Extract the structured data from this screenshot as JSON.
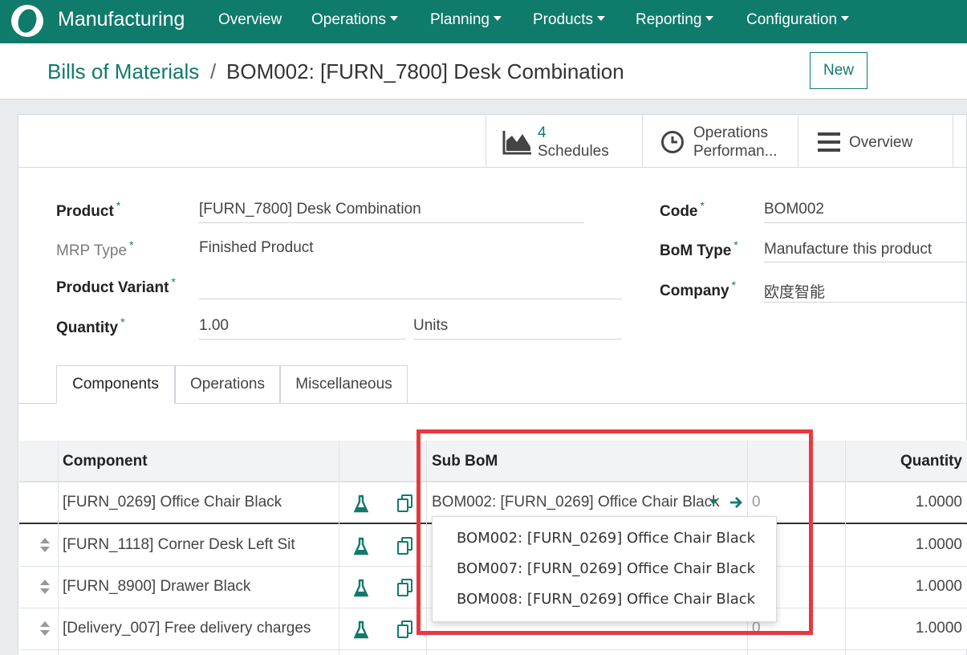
{
  "navbar": {
    "app_name": "Manufacturing",
    "menu": [
      "Overview",
      "Operations",
      "Planning",
      "Products",
      "Reporting",
      "Configuration"
    ]
  },
  "breadcrumb": {
    "parent": "Bills of Materials",
    "separator": "/",
    "current": "BOM002: [FURN_7800] Desk Combination"
  },
  "actions": {
    "new_label": "New"
  },
  "stat_buttons": {
    "schedules_count": "4",
    "schedules_label": "Schedules",
    "operations_line1": "Operations",
    "operations_line2": "Performan...",
    "overview_label": "Overview"
  },
  "form": {
    "product_label": "Product",
    "product_value": "[FURN_7800] Desk Combination",
    "mrp_type_label": "MRP Type",
    "mrp_type_value": "Finished Product",
    "variant_label": "Product Variant",
    "variant_value": "",
    "quantity_label": "Quantity",
    "quantity_value": "1.00",
    "uom_value": "Units",
    "code_label": "Code",
    "code_value": "BOM002",
    "bom_type_label": "BoM Type",
    "bom_type_value": "Manufacture this product",
    "company_label": "Company",
    "company_value": "欧度智能",
    "required_mark": "*"
  },
  "tabs": [
    "Components",
    "Operations",
    "Miscellaneous"
  ],
  "table": {
    "headers": {
      "component": "Component",
      "sub_bom": "Sub BoM",
      "quantity": "Quantity"
    },
    "rows": [
      {
        "component": "[FURN_0269] Office Chair Black",
        "sub_bom": "BOM002: [FURN_0269] Office Chair Black",
        "extra": "0",
        "quantity": "1.0000"
      },
      {
        "component": "[FURN_1118] Corner Desk Left Sit",
        "sub_bom": "",
        "extra": "",
        "quantity": "1.0000"
      },
      {
        "component": "[FURN_8900] Drawer Black",
        "sub_bom": "",
        "extra": "",
        "quantity": "1.0000"
      },
      {
        "component": "[Delivery_007] Free delivery charges",
        "sub_bom": "",
        "extra": "0",
        "quantity": "1.0000"
      }
    ]
  },
  "sub_bom_dropdown": {
    "options": [
      "BOM002: [FURN_0269] Office Chair Black",
      "BOM007: [FURN_0269] Office Chair Black",
      "BOM008: [FURN_0269] Office Chair Black"
    ]
  },
  "colors": {
    "brand": "#0f7b6b",
    "highlight": "#e8383f"
  }
}
